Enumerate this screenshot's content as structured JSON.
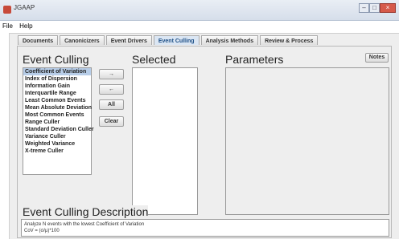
{
  "window": {
    "title": "JGAAP",
    "controls": [
      "minimize-icon",
      "maximize-icon",
      "close-icon"
    ]
  },
  "menu": [
    "File",
    "Help"
  ],
  "tabs": [
    {
      "label": "Documents",
      "active": false
    },
    {
      "label": "Canonicizers",
      "active": false
    },
    {
      "label": "Event Drivers",
      "active": false
    },
    {
      "label": "Event Culling",
      "active": true
    },
    {
      "label": "Analysis Methods",
      "active": false
    },
    {
      "label": "Review & Process",
      "active": false
    }
  ],
  "culling": {
    "heading": "Event Culling",
    "items": [
      "Coefficient of Variation",
      "Index of Dispersion",
      "Information Gain",
      "Interquartile Range",
      "Least Common Events",
      "Mean Absolute Deviation",
      "Most Common Events",
      "Range Culler",
      "Standard Deviation Culler",
      "Variance Culler",
      "Weighted Variance",
      "X-treme Culler"
    ],
    "selected_index": 0
  },
  "buttons": {
    "add": "→",
    "remove": "←",
    "all": "All",
    "clear": "Clear",
    "notes": "Notes"
  },
  "selected": {
    "heading": "Selected"
  },
  "parameters": {
    "heading": "Parameters"
  },
  "description": {
    "heading": "Event Culling Description",
    "line1": "Analyze N events with the lowest Coefficient of Variation",
    "line2": "CoV = (σ/μ)*100"
  }
}
